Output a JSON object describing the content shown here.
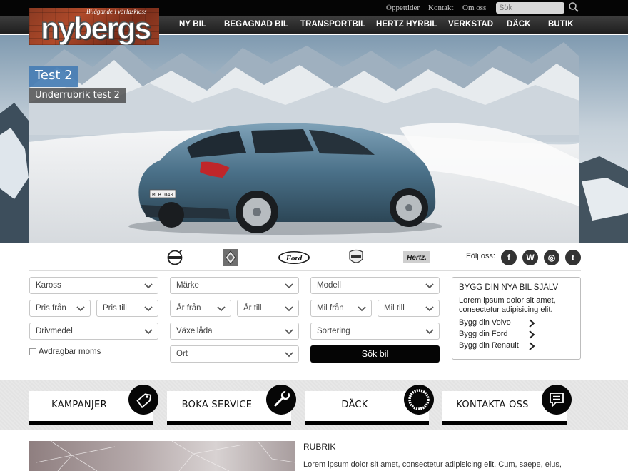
{
  "top_links": [
    {
      "label": "Öppettider"
    },
    {
      "label": "Kontakt"
    },
    {
      "label": "Om oss"
    }
  ],
  "search": {
    "placeholder": "Sök",
    "icon": "search-icon"
  },
  "logo": {
    "tagline": "Bilägande i världsklass",
    "text": "nybergs"
  },
  "nav": [
    {
      "label": "NY BIL"
    },
    {
      "label": "BEGAGNAD BIL"
    },
    {
      "label": "TRANSPORTBIL"
    },
    {
      "label": "HERTZ HYRBIL"
    },
    {
      "label": "VERKSTAD"
    },
    {
      "label": "DÄCK"
    },
    {
      "label": "BUTIK"
    }
  ],
  "hero": {
    "title": "Test 2",
    "subtitle": "Underrubrik test 2",
    "plate": "MLB 040"
  },
  "brands": {
    "ford": "Ford",
    "hertz": "Hertz.",
    "volvo_icon": "volvo-logo-icon",
    "renault_icon": "renault-logo-icon",
    "dacia_icon": "dacia-logo-icon"
  },
  "social": {
    "label": "Följ oss:",
    "items": [
      {
        "glyph": "f",
        "icon": "facebook-icon"
      },
      {
        "glyph": "W",
        "icon": "wordpress-icon"
      },
      {
        "glyph": "◎",
        "icon": "instagram-icon"
      },
      {
        "glyph": "t",
        "icon": "twitter-icon"
      }
    ]
  },
  "filters": {
    "kaross": "Kaross",
    "marke": "Märke",
    "modell": "Modell",
    "pris_fran": "Pris från",
    "pris_till": "Pris till",
    "ar_fran": "År från",
    "ar_till": "År till",
    "mil_fran": "Mil från",
    "mil_till": "Mil till",
    "drivmedel": "Drivmedel",
    "vaxellada": "Växellåda",
    "sortering": "Sortering",
    "ort": "Ort",
    "moms_label": "Avdragbar moms",
    "moms_checked": false,
    "submit": "Sök bil"
  },
  "build": {
    "title": "BYGG DIN NYA BIL SJÄLV",
    "text": "Lorem ipsum dolor sit amet, consectetur adipisicing elit.",
    "links": [
      {
        "label": "Bygg din Volvo"
      },
      {
        "label": "Bygg din Ford"
      },
      {
        "label": "Bygg din Renault"
      }
    ]
  },
  "features": [
    {
      "label": "KAMPANJER",
      "icon": "price-tag-icon"
    },
    {
      "label": "BOKA SERVICE",
      "icon": "wrench-icon"
    },
    {
      "label": "DÄCK",
      "icon": "tire-icon"
    },
    {
      "label": "KONTAKTA OSS",
      "icon": "chat-bubble-icon"
    }
  ],
  "article": {
    "title": "RUBRIK",
    "text": "Lorem ipsum dolor sit amet, consectetur adipisicing elit. Cum, saepe, eius,"
  }
}
